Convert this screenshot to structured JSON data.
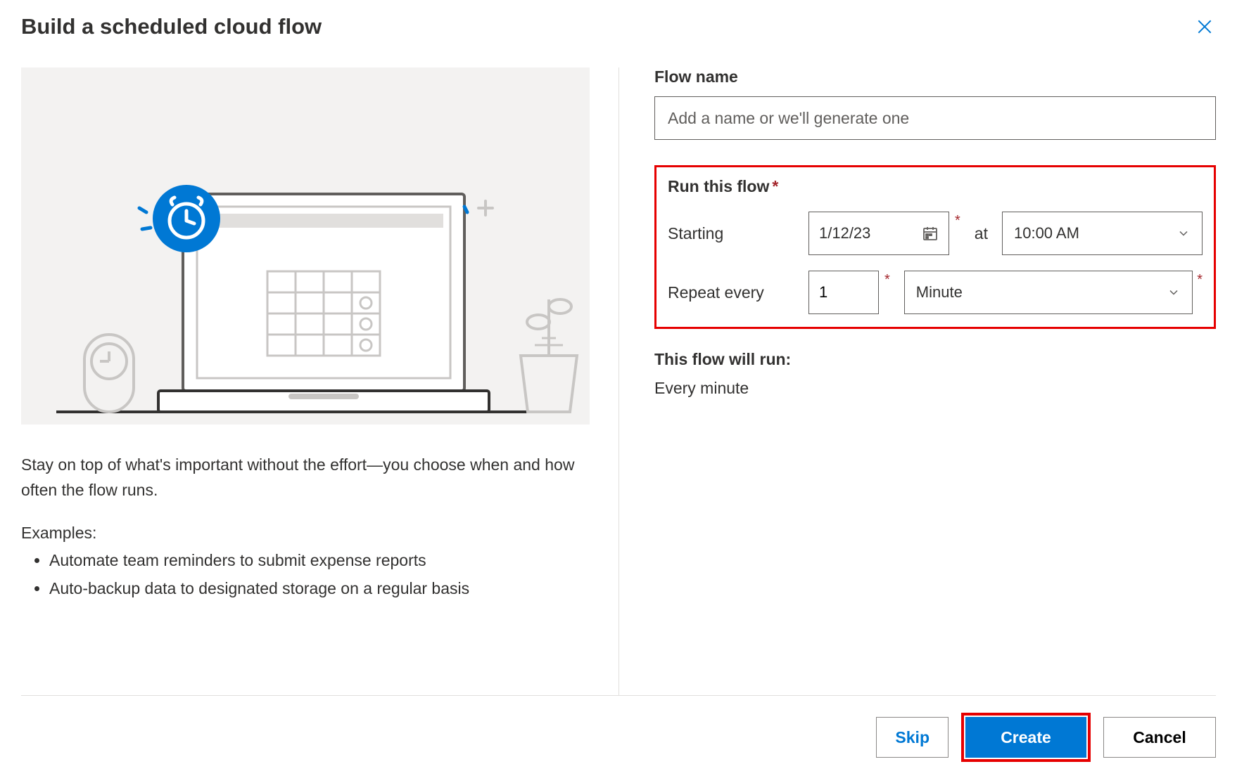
{
  "header": {
    "title": "Build a scheduled cloud flow"
  },
  "left": {
    "description": "Stay on top of what's important without the effort—you choose when and how often the flow runs.",
    "examples_label": "Examples:",
    "examples": [
      "Automate team reminders to submit expense reports",
      "Auto-backup data to designated storage on a regular basis"
    ]
  },
  "form": {
    "flow_name_label": "Flow name",
    "flow_name_placeholder": "Add a name or we'll generate one",
    "flow_name_value": "",
    "run_this_flow_label": "Run this flow",
    "starting_label": "Starting",
    "starting_date": "1/12/23",
    "at_label": "at",
    "starting_time": "10:00 AM",
    "repeat_label": "Repeat every",
    "repeat_value": "1",
    "repeat_unit": "Minute",
    "summary_label": "This flow will run:",
    "summary_text": "Every minute"
  },
  "footer": {
    "skip": "Skip",
    "create": "Create",
    "cancel": "Cancel"
  }
}
